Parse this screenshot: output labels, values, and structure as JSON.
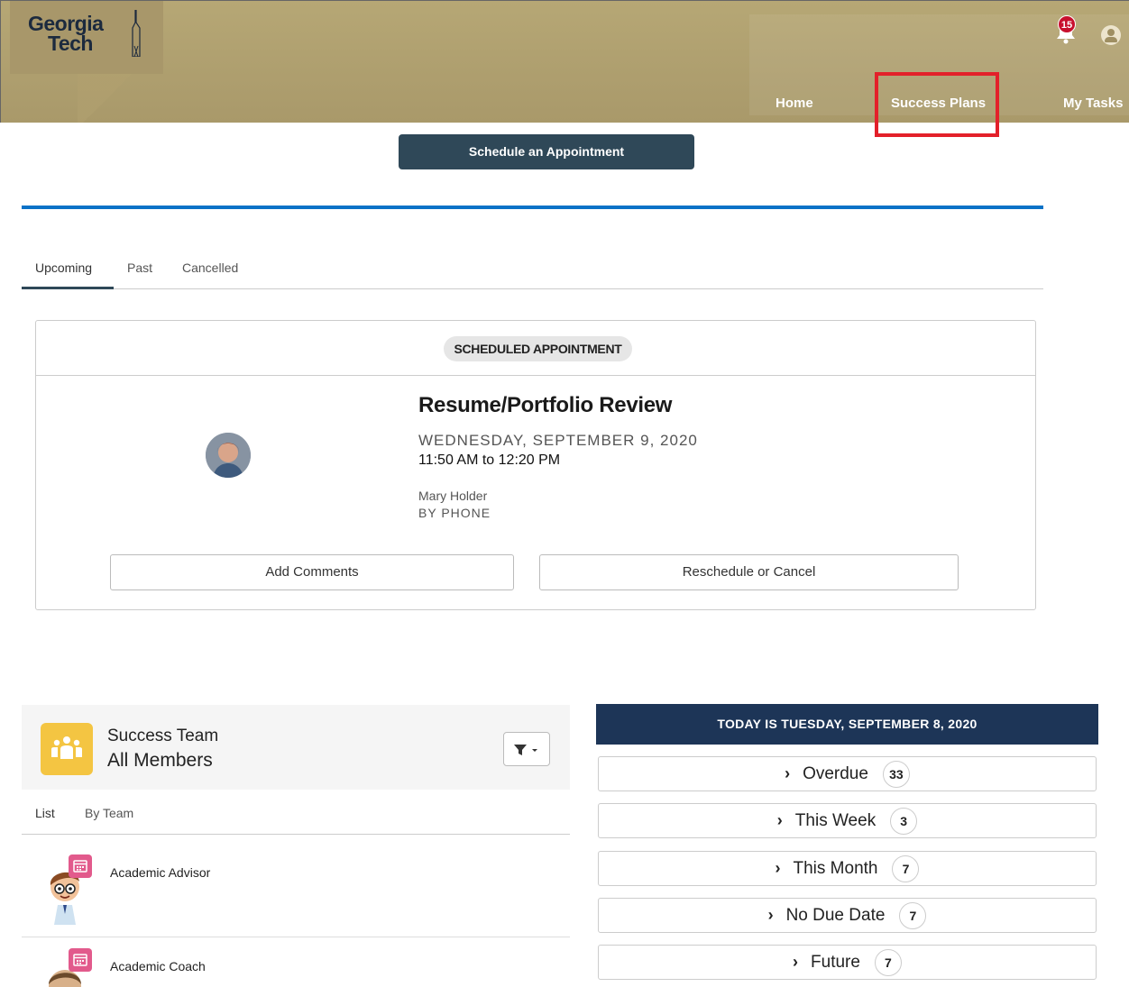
{
  "header": {
    "logo_line1": "Georgia",
    "logo_line2": "Tech",
    "nav": [
      "Home",
      "Success Plans",
      "My Tasks"
    ],
    "notification_count": "15",
    "brand_color": "#b3a369"
  },
  "schedule_button": "Schedule an Appointment",
  "tabs": [
    "Upcoming",
    "Past",
    "Cancelled"
  ],
  "appointment": {
    "badge": "SCHEDULED APPOINTMENT",
    "title": "Resume/Portfolio Review",
    "date": "WEDNESDAY, SEPTEMBER 9, 2020",
    "time": "11:50 AM to 12:20 PM",
    "person": "Mary Holder",
    "method": "BY PHONE",
    "add_comments": "Add Comments",
    "reschedule": "Reschedule or Cancel"
  },
  "success_team": {
    "title1": "Success Team",
    "title2": "All Members",
    "tabs": [
      "List",
      "By Team"
    ],
    "members": [
      "Academic Advisor",
      "Academic Coach"
    ]
  },
  "tasks": {
    "today": "TODAY IS TUESDAY, SEPTEMBER 8, 2020",
    "rows": [
      {
        "label": "Overdue",
        "count": "33"
      },
      {
        "label": "This Week",
        "count": "3"
      },
      {
        "label": "This Month",
        "count": "7"
      },
      {
        "label": "No Due Date",
        "count": "7"
      },
      {
        "label": "Future",
        "count": "7"
      }
    ]
  }
}
